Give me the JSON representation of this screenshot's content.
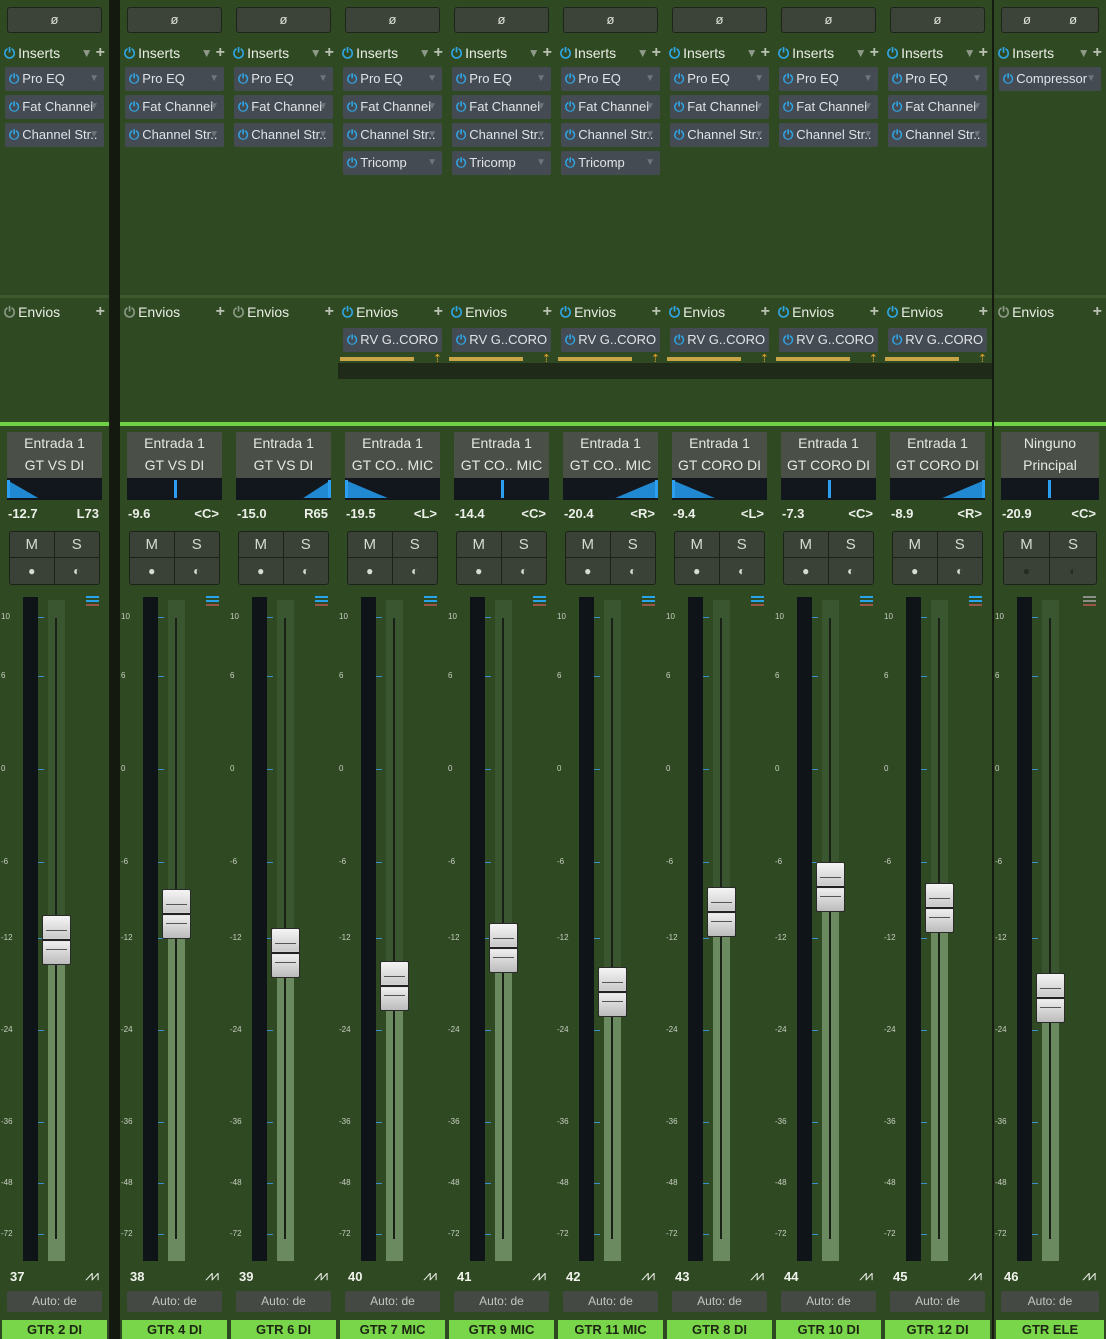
{
  "labels": {
    "phase": "ø",
    "inserts": "Inserts",
    "sends": "Envios",
    "mute": "M",
    "solo": "S",
    "record": "●",
    "monitor": "◐",
    "power_glyph": "⏻",
    "wave_glyph": "⩘⩘",
    "auto": "Auto: de",
    "meter_scale": [
      "10",
      "6",
      "0",
      "-6",
      "-12",
      "-24",
      "-36",
      "-48",
      "-72"
    ]
  },
  "channels": [
    {
      "number": "37",
      "name": "GTR  2 DI",
      "input": "Entrada 1",
      "output": "GT VS DI",
      "volume": "-12.7",
      "pan": "L73",
      "pan_value": -0.73,
      "fader_level": 0.487,
      "phase": [
        "ø"
      ],
      "inserts": [
        "Pro EQ",
        "Fat Channel",
        "Channel Str.."
      ],
      "inserts_active": true,
      "sends_active": false,
      "sends": []
    },
    {
      "number": "38",
      "name": "GTR  4 DI",
      "input": "Entrada 1",
      "output": "GT VS DI",
      "volume": "-9.6",
      "pan": "<C>",
      "pan_value": 0,
      "fader_level": 0.527,
      "phase": [
        "ø"
      ],
      "inserts": [
        "Pro EQ",
        "Fat Channel",
        "Channel Str.."
      ],
      "inserts_active": true,
      "sends_active": false,
      "sends": []
    },
    {
      "number": "39",
      "name": "GTR  6 DI",
      "input": "Entrada 1",
      "output": "GT VS DI",
      "volume": "-15.0",
      "pan": "R65",
      "pan_value": 0.65,
      "fader_level": 0.467,
      "phase": [
        "ø"
      ],
      "inserts": [
        "Pro EQ",
        "Fat Channel",
        "Channel Str.."
      ],
      "inserts_active": true,
      "sends_active": false,
      "sends": []
    },
    {
      "number": "40",
      "name": "GTR  7 MIC",
      "input": "Entrada 1",
      "output": "GT CO.. MIC",
      "volume": "-19.5",
      "pan": "<L>",
      "pan_value": -1,
      "fader_level": 0.418,
      "phase": [
        "ø"
      ],
      "inserts": [
        "Pro EQ",
        "Fat Channel",
        "Channel Str..",
        "Tricomp"
      ],
      "inserts_active": true,
      "sends_active": true,
      "sends": [
        "RV G..CORO"
      ]
    },
    {
      "number": "41",
      "name": "GTR  9 MIC",
      "input": "Entrada 1",
      "output": "GT CO.. MIC",
      "volume": "-14.4",
      "pan": "<C>",
      "pan_value": 0,
      "fader_level": 0.475,
      "phase": [
        "ø"
      ],
      "inserts": [
        "Pro EQ",
        "Fat Channel",
        "Channel Str..",
        "Tricomp"
      ],
      "inserts_active": true,
      "sends_active": true,
      "sends": [
        "RV G..CORO"
      ]
    },
    {
      "number": "42",
      "name": "GTR  11 MIC",
      "input": "Entrada 1",
      "output": "GT CO.. MIC",
      "volume": "-20.4",
      "pan": "<R>",
      "pan_value": 1,
      "fader_level": 0.408,
      "phase": [
        "ø"
      ],
      "inserts": [
        "Pro EQ",
        "Fat Channel",
        "Channel Str..",
        "Tricomp"
      ],
      "inserts_active": true,
      "sends_active": true,
      "sends": [
        "RV G..CORO"
      ]
    },
    {
      "number": "43",
      "name": "GTR  8 DI",
      "input": "Entrada 1",
      "output": "GT CORO DI",
      "volume": "-9.4",
      "pan": "<L>",
      "pan_value": -1,
      "fader_level": 0.53,
      "phase": [
        "ø"
      ],
      "inserts": [
        "Pro EQ",
        "Fat Channel",
        "Channel Str.."
      ],
      "inserts_active": true,
      "sends_active": true,
      "sends": [
        "RV G..CORO"
      ]
    },
    {
      "number": "44",
      "name": "GTR  10 DI",
      "input": "Entrada 1",
      "output": "GT CORO DI",
      "volume": "-7.3",
      "pan": "<C>",
      "pan_value": 0,
      "fader_level": 0.568,
      "phase": [
        "ø"
      ],
      "inserts": [
        "Pro EQ",
        "Fat Channel",
        "Channel Str.."
      ],
      "inserts_active": true,
      "sends_active": true,
      "sends": [
        "RV G..CORO"
      ]
    },
    {
      "number": "45",
      "name": "GTR  12 DI",
      "input": "Entrada 1",
      "output": "GT CORO DI",
      "volume": "-8.9",
      "pan": "<R>",
      "pan_value": 1,
      "fader_level": 0.535,
      "phase": [
        "ø"
      ],
      "inserts": [
        "Pro EQ",
        "Fat Channel",
        "Channel Str.."
      ],
      "inserts_active": true,
      "sends_active": true,
      "sends": [
        "RV G..CORO"
      ]
    },
    {
      "number": "46",
      "name": "GTR ELE",
      "input": "Ninguno",
      "output": "Principal",
      "volume": "-20.9",
      "pan": "<C>",
      "pan_value": 0,
      "fader_level": 0.4,
      "phase": [
        "ø",
        "ø"
      ],
      "inserts": [
        "Compressor"
      ],
      "inserts_active": true,
      "sends_active": false,
      "sends": [],
      "inactive_record": true
    }
  ],
  "colors": {
    "strip_bg": "#2f4a22",
    "name_bg": "#79d64b",
    "power_on": "#2fa6e6",
    "pan_blue": "#2189d2",
    "send_bar": "#c7a447",
    "selected_line": "#6ed146"
  }
}
